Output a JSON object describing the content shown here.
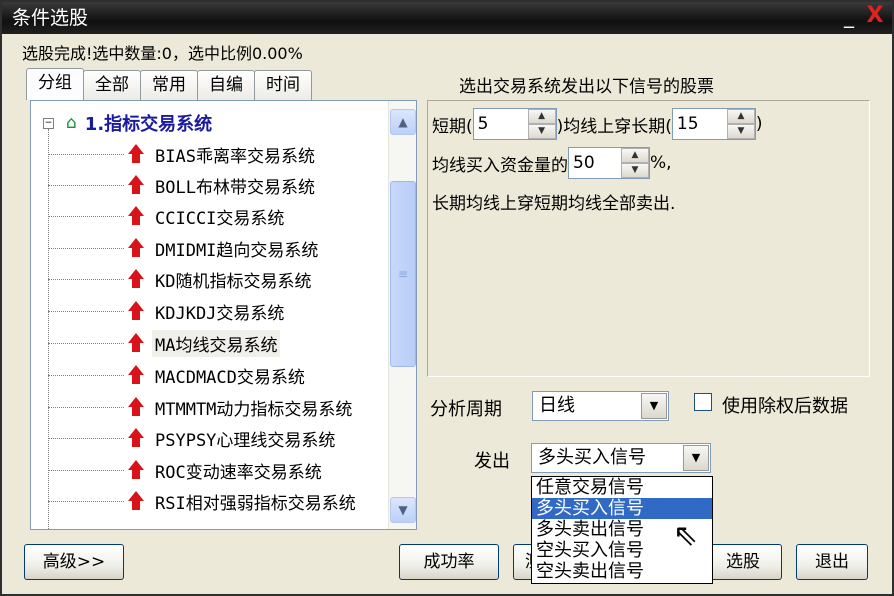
{
  "window": {
    "title": "条件选股"
  },
  "titlebar_buttons": {
    "minimize": "_",
    "close": "X"
  },
  "status_text": "选股完成!选中数量:0，选中比例0.00%",
  "tabs": [
    {
      "label": "分组",
      "active": true
    },
    {
      "label": "全部"
    },
    {
      "label": "常用"
    },
    {
      "label": "自编"
    },
    {
      "label": "时间"
    }
  ],
  "tree": {
    "expander": "−",
    "root_label": "1.指标交易系统",
    "items": [
      {
        "label": "BIAS乖离率交易系统"
      },
      {
        "label": "BOLL布林带交易系统"
      },
      {
        "label": "CCICCI交易系统"
      },
      {
        "label": "DMIDMI趋向交易系统"
      },
      {
        "label": "KD随机指标交易系统"
      },
      {
        "label": "KDJKDJ交易系统"
      },
      {
        "label": "MA均线交易系统",
        "selected": true
      },
      {
        "label": "MACDMACD交易系统"
      },
      {
        "label": "MTMMTM动力指标交易系统"
      },
      {
        "label": "PSYPSY心理线交易系统"
      },
      {
        "label": "ROC变动速率交易系统"
      },
      {
        "label": "RSI相对强弱指标交易系统"
      }
    ],
    "scroll": {
      "up": "▲",
      "down": "▼",
      "thumb_grip": "≡"
    }
  },
  "params": {
    "heading": "选出交易系统发出以下信号的股票",
    "short_label": "短期(",
    "short_value": "5",
    "long_label": ")均线上穿长期(",
    "long_value": "15",
    "long_close": ")",
    "fund_label": "均线买入资金量的",
    "fund_value": "50",
    "fund_suffix": "%,",
    "notice": "长期均线上穿短期均线全部卖出.",
    "spin_up": "▲",
    "spin_down": "▼"
  },
  "period": {
    "label": "分析周期",
    "value": "日线",
    "arrow": "▼"
  },
  "use_adjusted": {
    "label": "使用除权后数据",
    "checked": false
  },
  "signal": {
    "label": "发出",
    "value": "多头买入信号",
    "arrow": "▼",
    "options": [
      "任意交易信号",
      "多头买入信号",
      "多头卖出信号",
      "空头买入信号",
      "空头卖出信号"
    ],
    "highlighted_index": 1
  },
  "buttons": {
    "advanced": "高级>>",
    "success_rate": "成功率",
    "partial_left": "测",
    "select": "选股",
    "exit": "退出"
  }
}
